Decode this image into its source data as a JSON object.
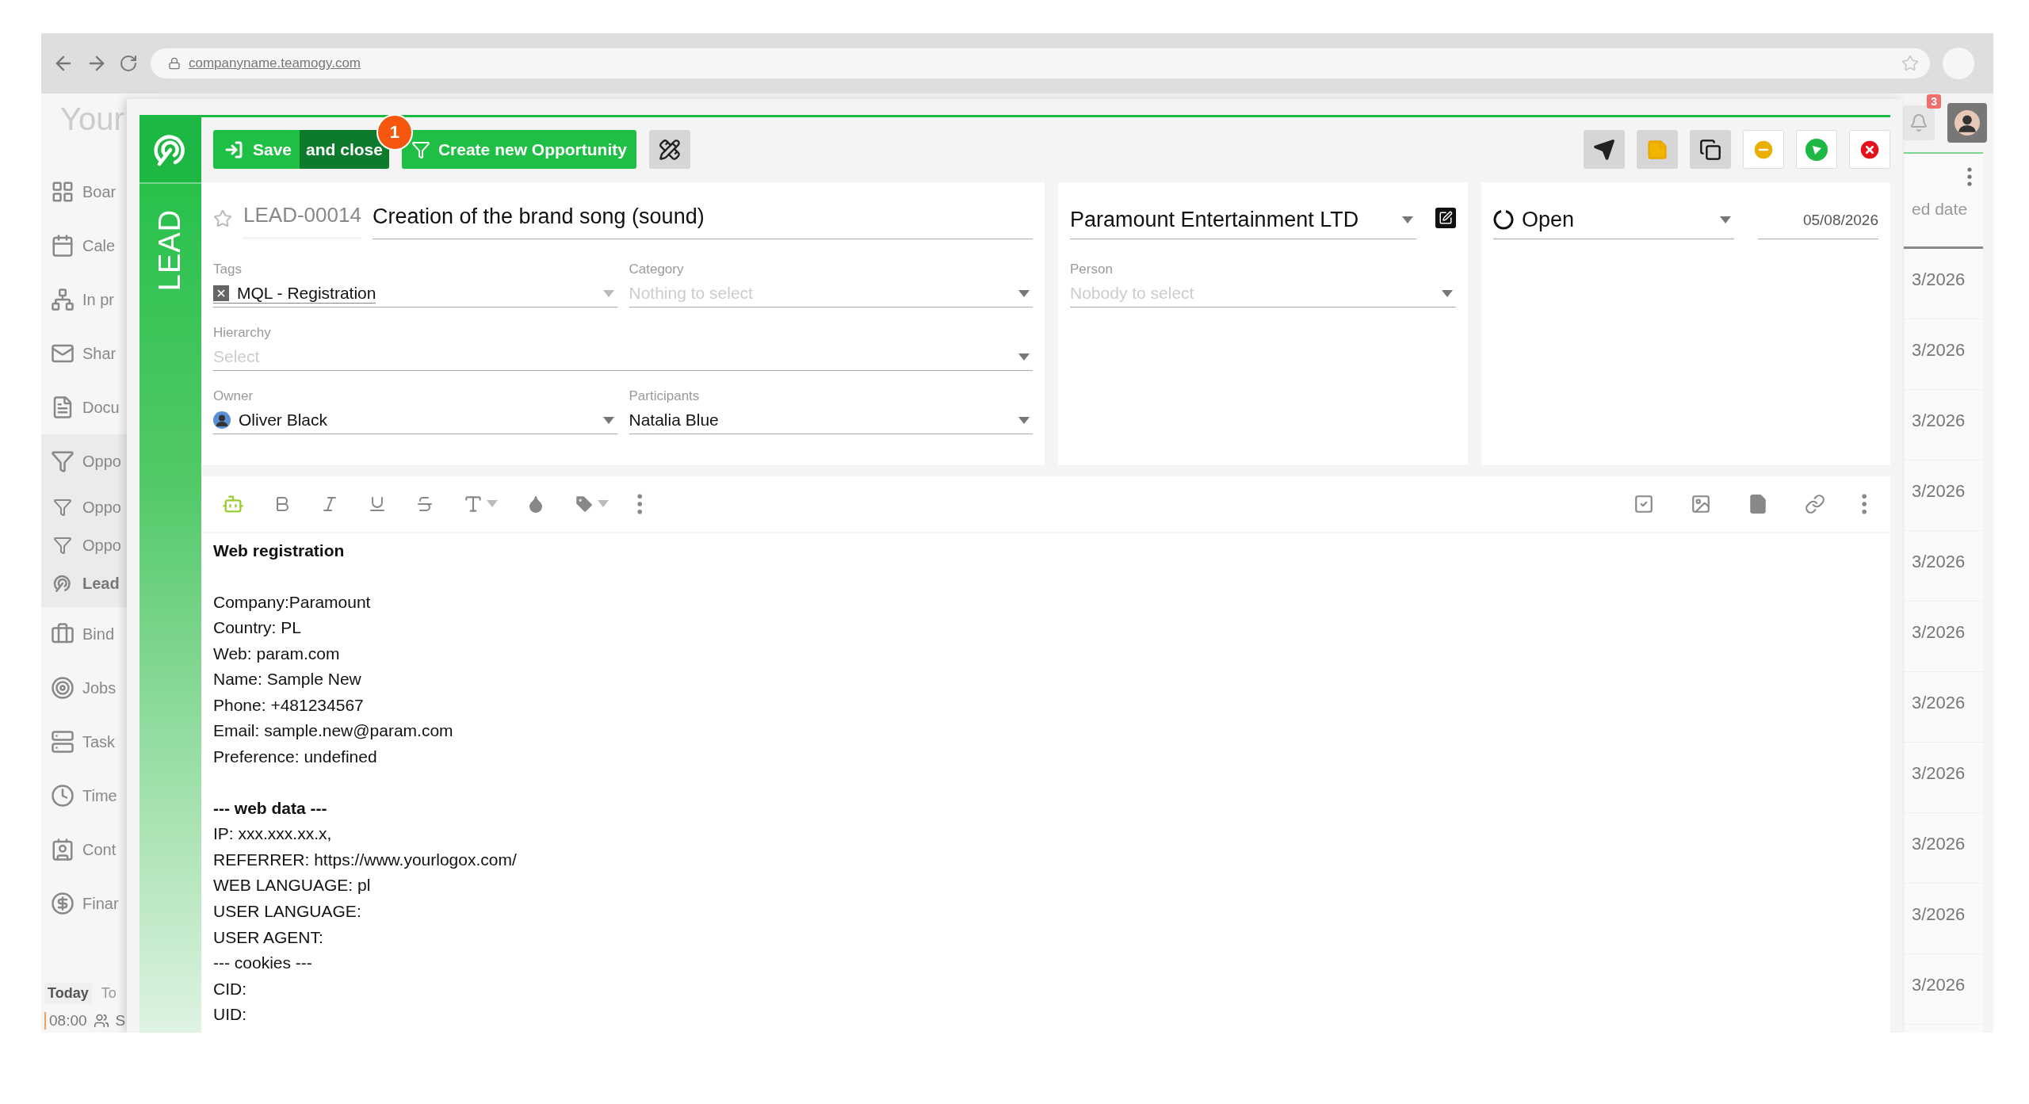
{
  "browser": {
    "url": "companyname.teamogy.com"
  },
  "app": {
    "logo": "Your",
    "sidebar": [
      {
        "label": "Boar",
        "selected": false
      },
      {
        "label": "Cale",
        "selected": false
      },
      {
        "label": "In pr",
        "selected": false
      },
      {
        "label": "Shar",
        "selected": false
      },
      {
        "label": "Docu",
        "selected": false
      },
      {
        "label": "Oppo",
        "selected": false,
        "expanded": true,
        "children": [
          {
            "label": "Oppo",
            "selected": false
          },
          {
            "label": "Oppo",
            "selected": false
          },
          {
            "label": "Lead",
            "selected": true
          }
        ]
      },
      {
        "label": "Bind",
        "selected": false
      },
      {
        "label": "Jobs",
        "selected": false
      },
      {
        "label": "Task",
        "selected": false
      },
      {
        "label": "Time",
        "selected": false
      },
      {
        "label": "Cont",
        "selected": false
      },
      {
        "label": "Finar",
        "selected": false
      }
    ],
    "day_tabs": [
      {
        "label": "Today",
        "selected": true
      },
      {
        "label": "To",
        "selected": false
      }
    ],
    "agenda": [
      {
        "time": "08:00",
        "title": "S"
      }
    ],
    "notifications": {
      "badge": "3"
    },
    "table": {
      "column": "ed date",
      "rows": [
        "3/2026",
        "3/2026",
        "3/2026",
        "3/2026",
        "3/2026",
        "3/2026",
        "3/2026",
        "3/2026",
        "3/2026",
        "3/2026",
        "3/2026"
      ]
    }
  },
  "modal": {
    "side_label": "LEAD",
    "toolbar": {
      "save": "Save",
      "save_close": "and close",
      "badge": "1",
      "create": "Create new Opportunity"
    },
    "record": {
      "starred": false,
      "number": "LEAD-00014",
      "title": "Creation of the brand song (sound)"
    },
    "tags": {
      "label": "Tags",
      "chips": [
        "MQL - Registration"
      ]
    },
    "category": {
      "label": "Category",
      "placeholder": "Nothing to select"
    },
    "hierarchy": {
      "label": "Hierarchy",
      "placeholder": "Select"
    },
    "owner": {
      "label": "Owner",
      "value": "Oliver Black"
    },
    "participants": {
      "label": "Participants",
      "value": "Natalia Blue"
    },
    "company": {
      "value": "Paramount Entertainment LTD"
    },
    "person": {
      "label": "Person",
      "placeholder": "Nobody to select"
    },
    "status": {
      "value": "Open"
    },
    "date": {
      "value": "05/08/2026"
    },
    "editor": {
      "blocks": [
        {
          "heading": "Web registration"
        },
        {
          "lines": [
            "Company:Paramount",
            "Country: PL",
            "Web: param.com",
            "Name: Sample New",
            "Phone: +481234567",
            "Email: sample.new@param.com",
            "Preference: undefined"
          ]
        },
        {
          "heading": "--- web data ---",
          "lines": [
            "IP: xxx.xxx.xx.x,",
            "REFERRER: https://www.yourlogox.com/",
            "WEB LANGUAGE: pl",
            "USER LANGUAGE:",
            "USER AGENT:",
            "--- cookies ---",
            "CID:",
            "UID:"
          ]
        }
      ]
    }
  }
}
